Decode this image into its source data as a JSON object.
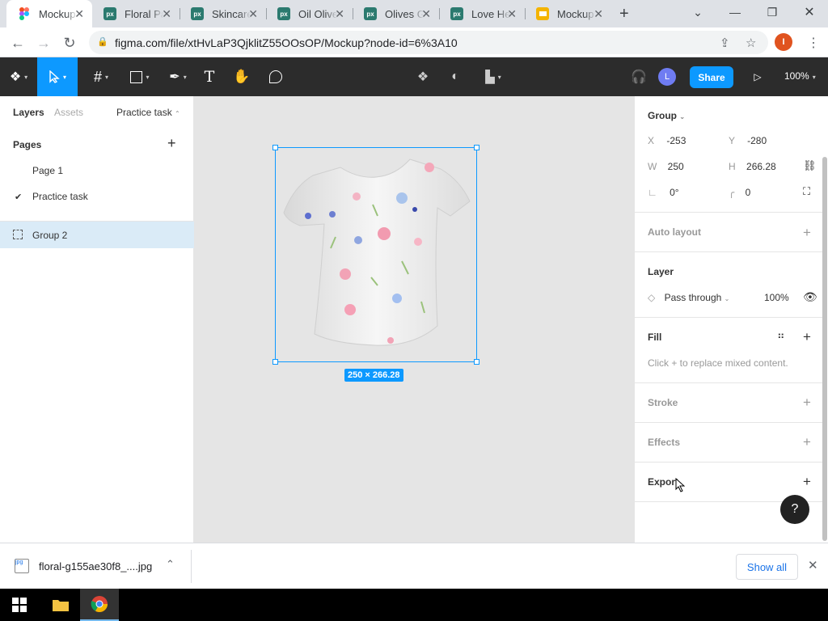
{
  "browser": {
    "tabs": [
      {
        "title": "Mockup",
        "favicon": "figma-icon",
        "active": true
      },
      {
        "title": "Floral Pa",
        "favicon": "px-icon"
      },
      {
        "title": "Skincare",
        "favicon": "px-icon"
      },
      {
        "title": "Oil Olive",
        "favicon": "px-icon"
      },
      {
        "title": "Olives G",
        "favicon": "px-icon"
      },
      {
        "title": "Love He",
        "favicon": "px-icon"
      },
      {
        "title": "Mockup",
        "favicon": "slides-icon"
      }
    ],
    "new_tab": "+",
    "url": "figma.com/file/xtHvLaP3QjklitZ55OOsOP/Mockup?node-id=6%3A10",
    "profile_initial": "I"
  },
  "toolbar": {
    "user_initial": "L",
    "share_label": "Share",
    "zoom": "100%"
  },
  "left_panel": {
    "tabs": [
      "Layers",
      "Assets"
    ],
    "page_dropdown": "Practice task",
    "pages_title": "Pages",
    "pages": [
      "Page 1",
      "Practice task"
    ],
    "layers": [
      "Group 2"
    ]
  },
  "canvas": {
    "dimensions_label": "250 × 266.28"
  },
  "right_panel": {
    "group_label": "Group",
    "x_label": "X",
    "x_value": "-253",
    "y_label": "Y",
    "y_value": "-280",
    "w_label": "W",
    "w_value": "250",
    "h_label": "H",
    "h_value": "266.28",
    "rotation_value": "0°",
    "radius_value": "0",
    "auto_layout": "Auto layout",
    "layer_title": "Layer",
    "blend_mode": "Pass through",
    "opacity": "100%",
    "fill_title": "Fill",
    "fill_note": "Click + to replace mixed content.",
    "stroke": "Stroke",
    "effects": "Effects",
    "export": "Export",
    "help": "?"
  },
  "download_bar": {
    "filename": "floral-g155ae30f8_....jpg",
    "show_all": "Show all"
  },
  "colors": {
    "accent": "#0d99ff",
    "toolbar_bg": "#2c2c2c",
    "canvas_bg": "#e5e5e5",
    "selected_layer": "#daebf7"
  }
}
